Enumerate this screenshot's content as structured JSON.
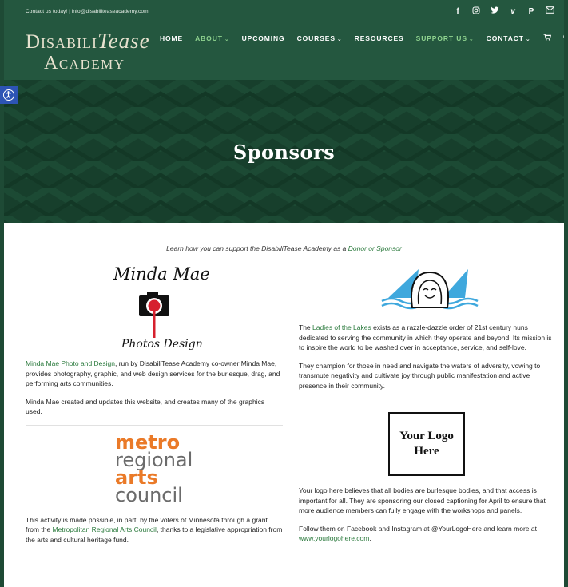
{
  "topbar": {
    "contact": "Contact us today!  |  info@disabiliteaseacademy.com",
    "social_icons": [
      "facebook-icon",
      "instagram-icon",
      "twitter-icon",
      "vimeo-icon",
      "paypal-icon",
      "mail-icon"
    ]
  },
  "logo": {
    "line1_a": "Disabili",
    "line1_b": "Tease",
    "line2": "Academy"
  },
  "nav": {
    "items": [
      {
        "label": "HOME",
        "dropdown": false,
        "highlight": false
      },
      {
        "label": "ABOUT",
        "dropdown": true,
        "highlight": true
      },
      {
        "label": "UPCOMING",
        "dropdown": false,
        "highlight": false
      },
      {
        "label": "COURSES",
        "dropdown": true,
        "highlight": false
      },
      {
        "label": "RESOURCES",
        "dropdown": false,
        "highlight": false
      },
      {
        "label": "SUPPORT US",
        "dropdown": true,
        "highlight": true
      },
      {
        "label": "CONTACT",
        "dropdown": true,
        "highlight": false
      }
    ],
    "chevron": "⌄"
  },
  "hero": {
    "title": "Sponsors"
  },
  "intro": {
    "text": "Learn how you can support the DisabiliTease Academy as a ",
    "link": "Donor or Sponsor"
  },
  "minda": {
    "logo_line1": "Minda Mae",
    "logo_line2": "Photos  Design",
    "link": "Minda Mae Photo and Design",
    "text1": ", run by DisabiliTease Academy co-owner Minda Mae, provides photography, graphic, and web design services for the burlesque, drag, and performing arts communities.",
    "text2": "Minda Mae created and updates this website, and creates many of the graphics used."
  },
  "metro": {
    "logo": [
      "metro",
      "regional",
      "arts",
      "council"
    ],
    "text_a": "This activity is made possible, in part, by the voters of Minnesota through a grant from the ",
    "link": "Metropolitan Regional Arts Council",
    "text_b": ", thanks to a legislative appropriation from the arts and cultural heritage fund."
  },
  "lakes": {
    "text_a": "The ",
    "link": "Ladies of the Lakes",
    "text_b": " exists as a razzle-dazzle order of 21st century nuns dedicated to serving the community in which they operate and beyond. Its mission is to inspire the world to be washed over in acceptance, service, and self-love.",
    "text2": "They champion for those in need and navigate the waters of adversity, vowing to transmute negativity and cultivate joy through public manifestation and active presence in their community."
  },
  "yourlogo": {
    "box_line1": "Your Logo",
    "box_line2": "Here",
    "text1": "Your logo here believes that all bodies are burlesque bodies, and that access is important for all. They are sponsoring our closed captioning for April to ensure that more audience members can fully engage with the workshops and panels.",
    "text2_a": "Follow them on Facebook and Instagram at @YourLogoHere and learn more at ",
    "link": "www.yourlogohere.com",
    "text2_b": "."
  },
  "colors": {
    "brand_green": "#24573f",
    "hero_green": "#173f2c",
    "link_green": "#2b7a3d",
    "accent_orange": "#ea7a28",
    "a11y_blue": "#2d54b5"
  }
}
